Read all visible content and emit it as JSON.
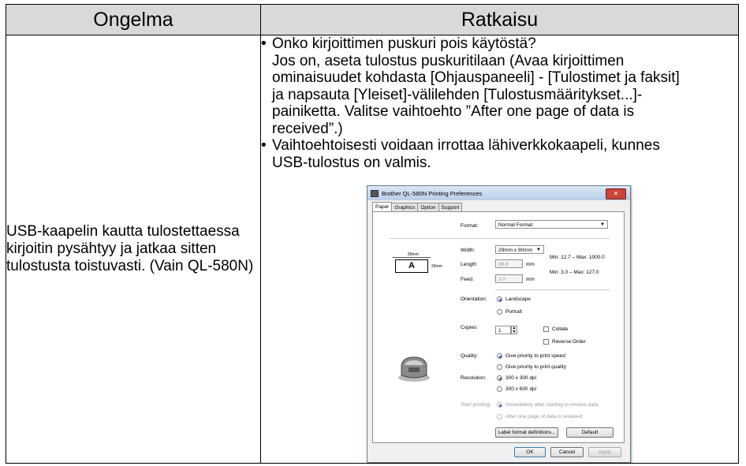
{
  "table": {
    "header_problem": "Ongelma",
    "header_solution": "Ratkaisu",
    "problem_text": "USB-kaapelin kautta tulostettaessa kirjoitin pysähtyy ja jatkaa sitten tulostusta toistuvasti. (Vain QL-580N)",
    "bullet_char": "•",
    "solution_lines": [
      "Onko kirjoittimen puskuri pois käytöstä?",
      "Jos on, aseta tulostus puskuritilaan (Avaa kirjoittimen",
      "ominaisuudet kohdasta [Ohjauspaneeli] - [Tulostimet ja faksit]",
      "ja napsauta [Yleiset]-välilehden [Tulostusmääritykset...]-",
      "painiketta. Valitse vaihtoehto ”After one page of data is",
      "received”.)",
      "Vaihtoehtoisesti voidaan irrottaa lähiverkkokaapeli, kunnes",
      "USB-tulostus on valmis."
    ]
  },
  "dialog": {
    "title": "Brother QL-580N Printing Preferences",
    "close_glyph": "✕",
    "tabs": [
      "Paper",
      "Graphics",
      "Option",
      "Support"
    ],
    "format_label": "Format:",
    "format_value": "Normal Format",
    "width_label": "Width:",
    "width_value": "29mm x 90mm",
    "length_label": "Length:",
    "length_value": "89.8",
    "length_unit": "mm",
    "length_range": "Min: 12.7 – Max: 1000.0",
    "feed_label": "Feed:",
    "feed_value": "3.0",
    "feed_unit": "mm",
    "feed_range": "Min: 3.0 – Max: 127.0",
    "preview_width": "90mm",
    "preview_height": "29mm",
    "preview_letter": "A",
    "orientation_label": "Orientation:",
    "orientation_landscape": "Landscape",
    "orientation_portrait": "Portrait",
    "copies_label": "Copies:",
    "copies_value": "1",
    "collate_label": "Collate",
    "reverse_label": "Reverse Order",
    "quality_label": "Quality:",
    "quality_speed": "Give priority to print speed",
    "quality_quality": "Give priority to print quality",
    "resolution_label": "Resolution:",
    "resolution_300": "300 x 300 dpi",
    "resolution_600": "300 x 600 dpi",
    "start_label": "Start printing:",
    "start_immediate": "Immediately after starting to receive data",
    "start_after_page": "After one page of data is received",
    "label_defs_button": "Label format definitions...",
    "default_button": "Default",
    "ok_button": "OK",
    "cancel_button": "Cancel",
    "apply_button": "Apply"
  }
}
